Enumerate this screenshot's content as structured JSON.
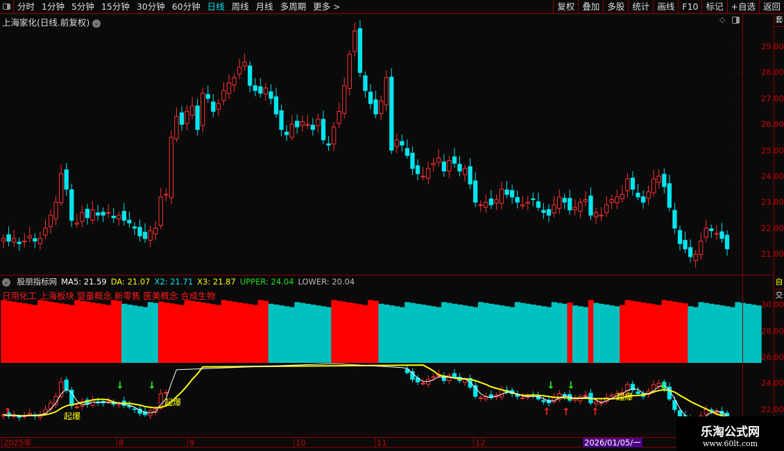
{
  "toolbar": {
    "periods": [
      "分时",
      "1分钟",
      "5分钟",
      "15分钟",
      "30分钟",
      "60分钟",
      "日线",
      "周线",
      "月线",
      "多周期",
      "更多 >"
    ],
    "active": "日线",
    "actions": [
      "复权",
      "叠加",
      "多股",
      "统计",
      "画线",
      "F10",
      "标记",
      "+自选",
      "返回"
    ]
  },
  "title": "上海家化(日线.前复权)",
  "main_axis": {
    "labels": [
      "29.00",
      "28.00",
      "27.00",
      "26.00",
      "25.00",
      "24.00",
      "23.00",
      "22.00",
      "21.00"
    ],
    "values": [
      29,
      28,
      27,
      26,
      25,
      24,
      23,
      22,
      21
    ]
  },
  "indicator": {
    "name": "股朋指标网",
    "items": [
      {
        "text": "MA5: 21.59",
        "color": "#ffffff"
      },
      {
        "text": "DA: 21.07",
        "color": "#ffff00"
      },
      {
        "text": "X2: 21.71",
        "color": "#00e5ee"
      },
      {
        "text": "X3: 21.87",
        "color": "#ffff00"
      },
      {
        "text": "UPPER: 24.04",
        "color": "#22dd22"
      },
      {
        "text": "LOWER: 20.04",
        "color": "#bbbbbb"
      }
    ],
    "sectors": "日用化工 上海板块 婴童概念 新零售 医美概念 合成生物",
    "marker_label": "起爆"
  },
  "lower_axis": {
    "labels": [
      "30.00",
      "28.00",
      "26.00",
      "24.00",
      "22.00"
    ],
    "values": [
      30,
      28,
      26,
      24,
      22
    ]
  },
  "date_axis": {
    "labels": [
      "2025年",
      "8",
      "9",
      "10",
      "11",
      "12"
    ],
    "current": "2026/01/05/一"
  },
  "right_col": {
    "top": [
      "套"
    ],
    "bottom": [
      "自",
      "交"
    ]
  },
  "watermark": {
    "name": "乐淘公式网",
    "url": "www.60lt.com"
  },
  "colors": {
    "up": "#ff3232",
    "down": "#00e5ee",
    "band_red": "#ff0000",
    "band_teal": "#00c0c0",
    "ma_yellow": "#ffff00",
    "ma_white": "#ffffff",
    "axis": "#8b0000"
  },
  "chart_data": {
    "type": "candlestick",
    "ylim": [
      20.5,
      29.8
    ],
    "closes": [
      21.6,
      21.5,
      21.6,
      21.4,
      21.5,
      21.7,
      21.5,
      21.6,
      22.0,
      22.5,
      23.0,
      24.1,
      23.5,
      22.3,
      22.2,
      22.6,
      22.4,
      22.7,
      22.5,
      22.5,
      22.6,
      22.4,
      22.5,
      22.3,
      22.2,
      22.0,
      21.7,
      21.6,
      21.9,
      22.0,
      23.2,
      23.3,
      25.5,
      26.3,
      26.0,
      26.5,
      26.7,
      25.8,
      27.2,
      27.0,
      26.5,
      26.8,
      27.3,
      27.6,
      27.8,
      28.2,
      28.4,
      27.5,
      27.3,
      27.2,
      27.4,
      27.0,
      26.4,
      25.8,
      25.6,
      26.0,
      25.9,
      26.1,
      26.0,
      25.8,
      26.2,
      25.4,
      25.2,
      25.9,
      26.5,
      27.5,
      28.7,
      29.6,
      28.0,
      27.3,
      26.8,
      26.4,
      26.9,
      27.8,
      25.0,
      25.4,
      25.2,
      24.8,
      24.3,
      24.1,
      24.0,
      24.3,
      24.5,
      24.7,
      24.2,
      24.6,
      24.5,
      24.2,
      24.3,
      23.7,
      23.0,
      22.9,
      23.0,
      22.9,
      23.1,
      23.5,
      23.3,
      23.2,
      23.0,
      22.9,
      23.0,
      23.1,
      22.8,
      22.6,
      22.5,
      22.9,
      23.2,
      23.0,
      22.7,
      22.8,
      23.0,
      23.1,
      22.5,
      22.6,
      22.5,
      22.9,
      23.1,
      23.2,
      23.3,
      23.9,
      23.5,
      23.2,
      23.0,
      23.4,
      23.9,
      24.0,
      23.6,
      22.8,
      22.0,
      21.4,
      21.2,
      20.9,
      21.0,
      21.5,
      22.0,
      21.9,
      21.8,
      21.6,
      21.2
    ],
    "band_segments": [
      [
        "red",
        0,
        22
      ],
      [
        "teal",
        23,
        29
      ],
      [
        "red",
        30,
        50
      ],
      [
        "teal",
        51,
        62
      ],
      [
        "red",
        63,
        71
      ],
      [
        "teal",
        72,
        107
      ],
      [
        "red",
        108,
        108
      ],
      [
        "teal",
        109,
        111
      ],
      [
        "red",
        112,
        112
      ],
      [
        "teal",
        113,
        117
      ],
      [
        "red",
        118,
        130
      ],
      [
        "teal",
        131,
        144
      ]
    ]
  }
}
